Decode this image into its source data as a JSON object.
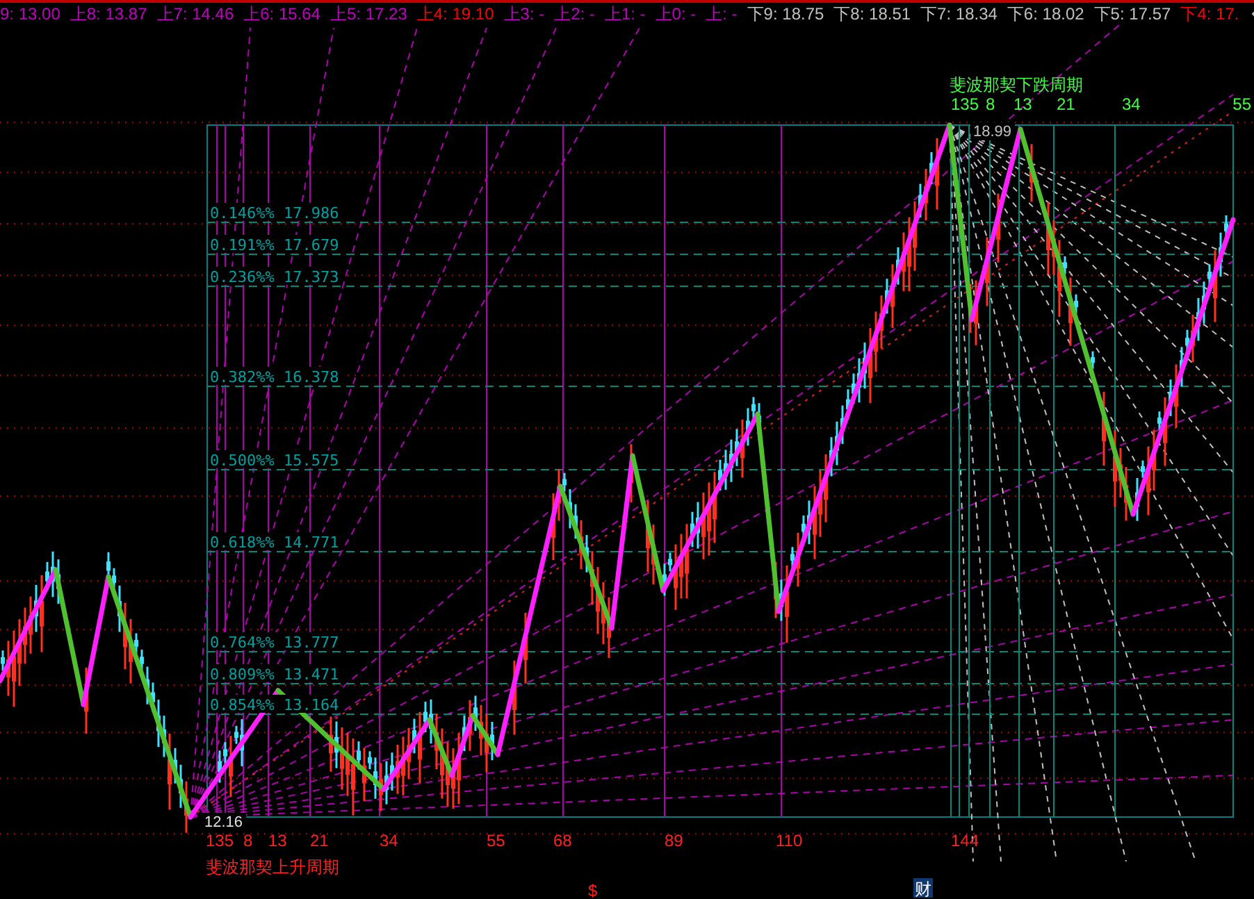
{
  "top_bar": {
    "items": [
      {
        "text": "9: 13.00",
        "color": "#c000c0"
      },
      {
        "text": "上8: 13.87",
        "color": "#c000c0"
      },
      {
        "text": "上7: 14.46",
        "color": "#c000c0"
      },
      {
        "text": "上6: 15.64",
        "color": "#c000c0"
      },
      {
        "text": "上5: 17.23",
        "color": "#c000c0"
      },
      {
        "text": "上4: 19.10",
        "color": "#ff0000"
      },
      {
        "text": "上3: -",
        "color": "#c000c0"
      },
      {
        "text": "上2: -",
        "color": "#c000c0"
      },
      {
        "text": "上1: -",
        "color": "#c000c0"
      },
      {
        "text": "上0: -",
        "color": "#c000c0"
      },
      {
        "text": "上: -",
        "color": "#c000c0"
      },
      {
        "text": "下9: 18.75",
        "color": "#c0c0c0"
      },
      {
        "text": "下8: 18.51",
        "color": "#c0c0c0"
      },
      {
        "text": "下7: 18.34",
        "color": "#c0c0c0"
      },
      {
        "text": "下6: 18.02",
        "color": "#c0c0c0"
      },
      {
        "text": "下5: 17.57",
        "color": "#c0c0c0"
      },
      {
        "text": "下4: 17.",
        "color": "#ff0000"
      }
    ]
  },
  "chart": {
    "fib_levels": [
      {
        "label": "0.146%% 17.986"
      },
      {
        "label": "0.191%% 17.679"
      },
      {
        "label": "0.236%% 17.373"
      },
      {
        "label": "0.382%% 16.378"
      },
      {
        "label": "0.500%% 15.575"
      },
      {
        "label": "0.618%% 14.771"
      },
      {
        "label": "0.764%% 13.777"
      },
      {
        "label": "0.809%% 13.471"
      },
      {
        "label": "0.854%% 13.164"
      }
    ],
    "high_price": "18.99",
    "low_price": "12.16",
    "rise_cycle": {
      "title": "斐波那契上升周期",
      "days": [
        "135",
        "8",
        "13",
        "21",
        "34",
        "55",
        "68",
        "89",
        "110",
        "144"
      ]
    },
    "fall_cycle": {
      "title": "斐波那契下跌周期",
      "days": [
        "135",
        "8",
        "13",
        "21",
        "34",
        "55"
      ]
    },
    "markers": [
      {
        "kind": "signal",
        "text": "$"
      },
      {
        "kind": "finance",
        "text": "财"
      }
    ]
  }
}
